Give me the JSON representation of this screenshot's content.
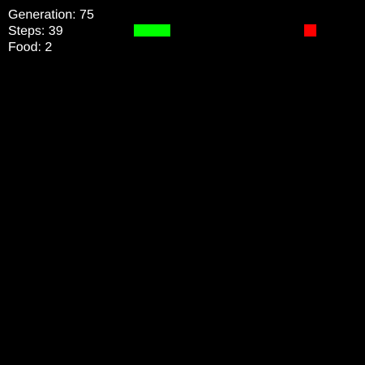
{
  "stats": {
    "generation_label": "Generation: 75",
    "steps_label": "Steps: 39",
    "food_label": "Food: 2"
  },
  "snake": {
    "color": "#00ff00",
    "segments": 3
  },
  "food_item": {
    "color": "#ff0000"
  },
  "board": {
    "background": "#000000"
  }
}
